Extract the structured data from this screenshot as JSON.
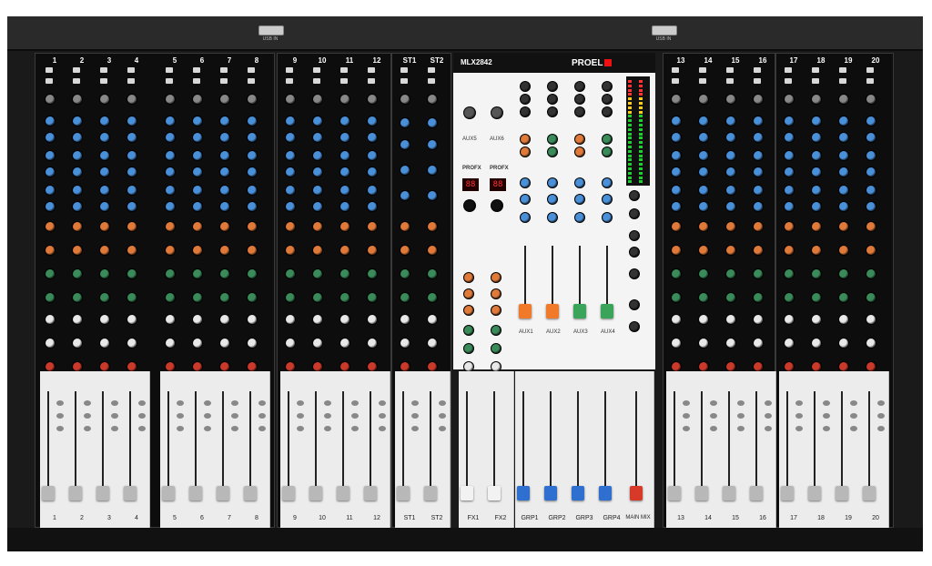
{
  "console": {
    "brand": "PROEL",
    "model": "MLX2842",
    "usb_left_label": "USB IN",
    "usb_right_label": "USB IN"
  },
  "mono_channels": [
    "1",
    "2",
    "3",
    "4",
    "5",
    "6",
    "7",
    "8",
    "9",
    "10",
    "11",
    "12"
  ],
  "stereo_channels": [
    "ST1",
    "ST2"
  ],
  "mono_channels_right": [
    "13",
    "14",
    "15",
    "16",
    "17",
    "18",
    "19",
    "20"
  ],
  "master": {
    "fx_labels": [
      "PROFX",
      "PROFX"
    ],
    "aux_labels": [
      "AUX5",
      "AUX6"
    ],
    "aux_send_labels": [
      "AUX1",
      "AUX2",
      "AUX3",
      "AUX4"
    ],
    "fx_displays": [
      "88",
      "88"
    ]
  },
  "bottom_labels": {
    "left": [
      "1",
      "2",
      "3",
      "4",
      "5",
      "6",
      "7",
      "8",
      "9",
      "10",
      "11",
      "12",
      "ST1",
      "ST2"
    ],
    "master": [
      "FX1",
      "FX2",
      "GRP1",
      "GRP2",
      "GRP3",
      "GRP4",
      "MAIN MIX"
    ],
    "right": [
      "13",
      "14",
      "15",
      "16",
      "17",
      "18",
      "19",
      "20"
    ]
  },
  "colors": {
    "knob_blue": "#4a90d9",
    "knob_orange": "#e07a3a",
    "knob_green": "#3a8a5a",
    "knob_white": "#e8e8e8",
    "knob_red": "#c93a2a",
    "cap_grey": "#b8b8b8",
    "cap_white": "#f2f2f2",
    "cap_blue": "#2e6fd0",
    "cap_red": "#d83a2a",
    "cap_orange": "#f07a2a",
    "cap_green": "#3aa45a"
  }
}
